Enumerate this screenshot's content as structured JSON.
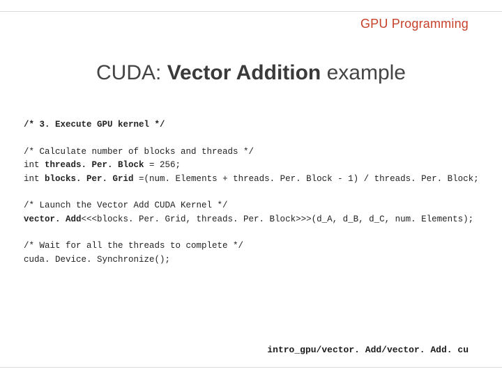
{
  "header": {
    "label": "GPU Programming"
  },
  "title": {
    "prefix": "CUDA:   ",
    "bold": "Vector Addition",
    "suffix": "   example"
  },
  "code": {
    "l01_bold": "/* 3. Execute GPU kernel */",
    "l02": "",
    "l03": "/* Calculate number of blocks and threads */",
    "l04_a": "int ",
    "l04_b_bold": "threads. Per. Block",
    "l04_c": " = 256;",
    "l05_a": "int ",
    "l05_b_bold": "blocks. Per. Grid",
    "l05_c": " =(num. Elements + threads. Per. Block - 1) / threads. Per. Block;",
    "l06": "",
    "l07": "/* Launch the Vector Add CUDA Kernel */",
    "l08_a_bold": "vector. Add",
    "l08_b": "<<<blocks. Per. Grid, threads. Per. Block>>>(d_A, d_B, d_C, num. Elements);",
    "l09": "",
    "l10": "/* Wait for all the threads to complete */",
    "l11": "cuda. Device. Synchronize();"
  },
  "footer": {
    "path": "intro_gpu/vector. Add/vector. Add. cu"
  }
}
